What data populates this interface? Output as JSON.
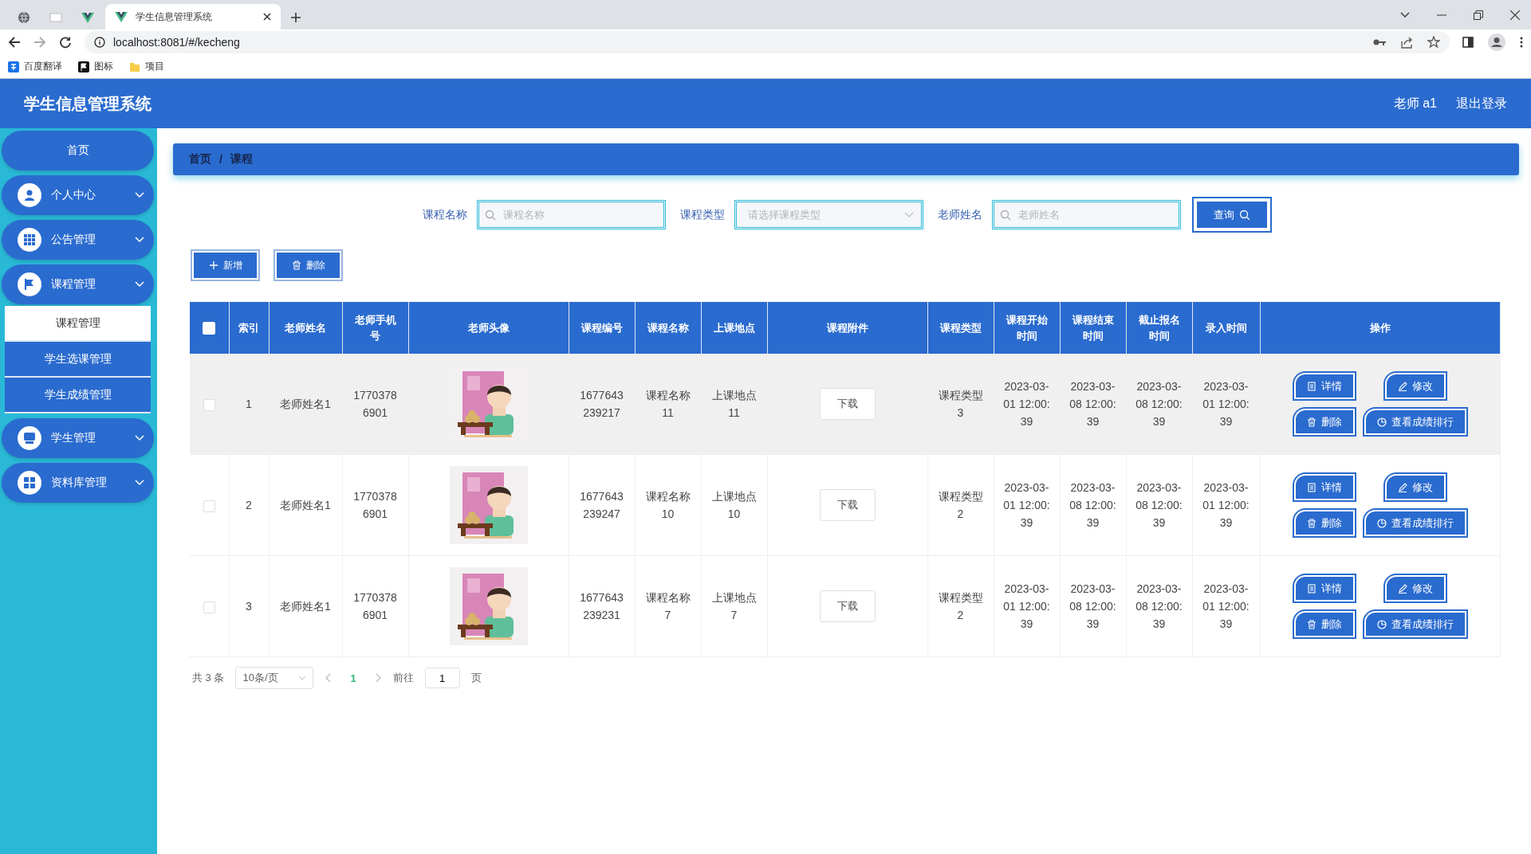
{
  "browser": {
    "tabs": [
      {
        "title": "学生信息管理系统",
        "selected": true
      }
    ],
    "url": "localhost:8081/#/kecheng",
    "bookmarks": [
      "百度翻译",
      "图标",
      "项目"
    ]
  },
  "header": {
    "title": "学生信息管理系统",
    "user": "老师 a1",
    "logout": "退出登录"
  },
  "sidebar": {
    "items": [
      {
        "label": "首页",
        "kind": "link"
      },
      {
        "label": "个人中心",
        "kind": "menu"
      },
      {
        "label": "公告管理",
        "kind": "menu"
      },
      {
        "label": "课程管理",
        "kind": "menu",
        "expanded": true,
        "children": [
          {
            "label": "课程管理",
            "selected": true
          },
          {
            "label": "学生选课管理",
            "selected": false
          },
          {
            "label": "学生成绩管理",
            "selected": false
          }
        ]
      },
      {
        "label": "学生管理",
        "kind": "menu"
      },
      {
        "label": "资料库管理",
        "kind": "menu"
      }
    ]
  },
  "breadcrumb": {
    "items": [
      "首页",
      "课程"
    ],
    "separator": "/"
  },
  "search": {
    "fields": [
      {
        "label": "课程名称",
        "placeholder": "课程名称",
        "kind": "text"
      },
      {
        "label": "课程类型",
        "placeholder": "请选择课程类型",
        "kind": "select"
      },
      {
        "label": "老师姓名",
        "placeholder": "老师姓名",
        "kind": "text"
      }
    ],
    "button": "查询"
  },
  "actions": [
    {
      "label": "新增",
      "kind": "add"
    },
    {
      "label": "删除",
      "kind": "delete"
    }
  ],
  "table": {
    "select_all": {
      "checked": false
    },
    "columns": [
      "索引",
      "老师姓名",
      "老师手机号",
      "老师头像",
      "课程编号",
      "课程名称",
      "上课地点",
      "课程附件",
      "课程类型",
      "课程开始时间",
      "课程结束时间",
      "截止报名时间",
      "录入时间",
      "操作"
    ],
    "rows": [
      {
        "checked": false,
        "highlighted": true,
        "cells": [
          "1",
          "老师姓名1",
          "17703786901",
          {
            "kind": "picture"
          },
          "1677643239217",
          "课程名称11",
          "上课地点11",
          {
            "kind": "button",
            "label": "下载"
          },
          "课程类型3",
          "2023-03-01 12:00:39",
          "2023-03-08 12:00:39",
          "2023-03-08 12:00:39",
          "2023-03-01 12:00:39"
        ],
        "actions": [
          {
            "label": "详情",
            "kind": "detail"
          },
          {
            "label": "修改",
            "kind": "edit"
          },
          {
            "label": "删除",
            "kind": "delete"
          },
          {
            "label": "查看成绩排行",
            "kind": "rank"
          }
        ]
      },
      {
        "checked": false,
        "highlighted": false,
        "cells": [
          "2",
          "老师姓名1",
          "17703786901",
          {
            "kind": "picture"
          },
          "1677643239247",
          "课程名称10",
          "上课地点10",
          {
            "kind": "button",
            "label": "下载"
          },
          "课程类型2",
          "2023-03-01 12:00:39",
          "2023-03-08 12:00:39",
          "2023-03-08 12:00:39",
          "2023-03-01 12:00:39"
        ],
        "actions": [
          {
            "label": "详情",
            "kind": "detail"
          },
          {
            "label": "修改",
            "kind": "edit"
          },
          {
            "label": "删除",
            "kind": "delete"
          },
          {
            "label": "查看成绩排行",
            "kind": "rank"
          }
        ]
      },
      {
        "checked": false,
        "highlighted": false,
        "cells": [
          "3",
          "老师姓名1",
          "17703786901",
          {
            "kind": "picture"
          },
          "1677643239231",
          "课程名称7",
          "上课地点7",
          {
            "kind": "button",
            "label": "下载"
          },
          "课程类型2",
          "2023-03-01 12:00:39",
          "2023-03-08 12:00:39",
          "2023-03-08 12:00:39",
          "2023-03-01 12:00:39"
        ],
        "actions": [
          {
            "label": "详情",
            "kind": "detail"
          },
          {
            "label": "修改",
            "kind": "edit"
          },
          {
            "label": "删除",
            "kind": "delete"
          },
          {
            "label": "查看成绩排行",
            "kind": "rank"
          }
        ]
      }
    ]
  },
  "pagination": {
    "total": "共 3 条",
    "page_size": "10条/页",
    "pages": [
      {
        "label": "1",
        "selected": true
      }
    ],
    "goto_label": "前往",
    "goto_value": "1",
    "goto_suffix": "页"
  }
}
